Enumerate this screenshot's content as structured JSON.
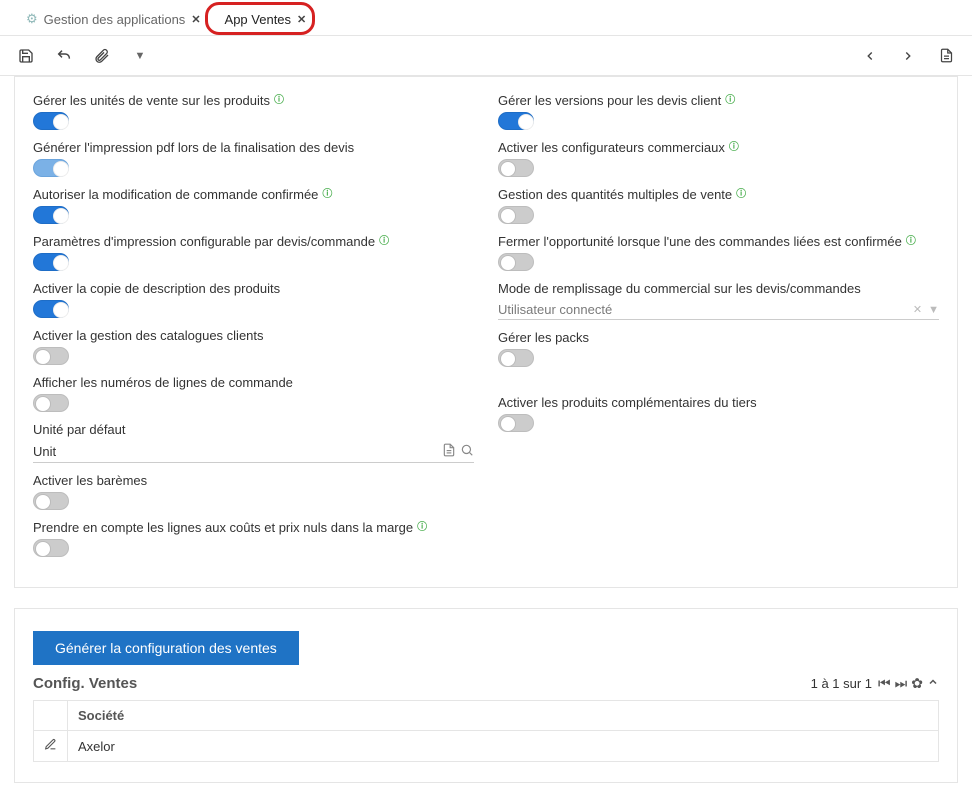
{
  "tabs": {
    "items": [
      {
        "label": "Gestion des applications",
        "active": false
      },
      {
        "label": "App Ventes",
        "active": true
      }
    ]
  },
  "toolbar": {},
  "left_fields": [
    {
      "label": "Gérer les unités de vente sur les produits",
      "info": true,
      "type": "toggle",
      "on": true
    },
    {
      "label": "Générer l'impression pdf lors de la finalisation des devis",
      "info": false,
      "type": "toggle",
      "on": true,
      "muted": true
    },
    {
      "label": "Autoriser la modification de commande confirmée",
      "info": true,
      "type": "toggle",
      "on": true
    },
    {
      "label": "Paramètres d'impression configurable par devis/commande",
      "info": true,
      "type": "toggle",
      "on": true
    },
    {
      "label": "Activer la copie de description des produits",
      "info": false,
      "type": "toggle",
      "on": true
    },
    {
      "label": "Activer la gestion des catalogues clients",
      "info": false,
      "type": "toggle",
      "on": false
    },
    {
      "label": "Afficher les numéros de lignes de commande",
      "info": false,
      "type": "toggle",
      "on": false
    },
    {
      "label": "Unité par défaut",
      "info": false,
      "type": "input",
      "value": "Unit"
    },
    {
      "label": "Activer les barèmes",
      "info": false,
      "type": "toggle",
      "on": false
    },
    {
      "label": "Prendre en compte les lignes aux coûts et prix nuls dans la marge",
      "info": true,
      "type": "toggle",
      "on": false
    }
  ],
  "right_fields": [
    {
      "label": "Gérer les versions pour les devis client",
      "info": true,
      "type": "toggle",
      "on": true
    },
    {
      "label": "Activer les configurateurs commerciaux",
      "info": true,
      "type": "toggle",
      "on": false
    },
    {
      "label": "Gestion des quantités multiples de vente",
      "info": true,
      "type": "toggle",
      "on": false
    },
    {
      "label": "Fermer l'opportunité lorsque l'une des commandes liées est confirmée",
      "info": true,
      "type": "toggle",
      "on": false
    },
    {
      "label": "Mode de remplissage du commercial sur les devis/commandes",
      "info": false,
      "type": "select",
      "value": "Utilisateur connecté"
    },
    {
      "label": "Gérer les packs",
      "info": false,
      "type": "toggle",
      "on": false
    },
    {
      "label": "Activer les produits complémentaires du tiers",
      "info": false,
      "type": "toggle",
      "on": false
    }
  ],
  "config_section": {
    "button_label": "Générer la configuration des ventes",
    "title": "Config. Ventes",
    "pager_text": "1 à 1 sur 1",
    "columns": [
      "Société"
    ],
    "rows": [
      {
        "societe": "Axelor"
      }
    ]
  }
}
